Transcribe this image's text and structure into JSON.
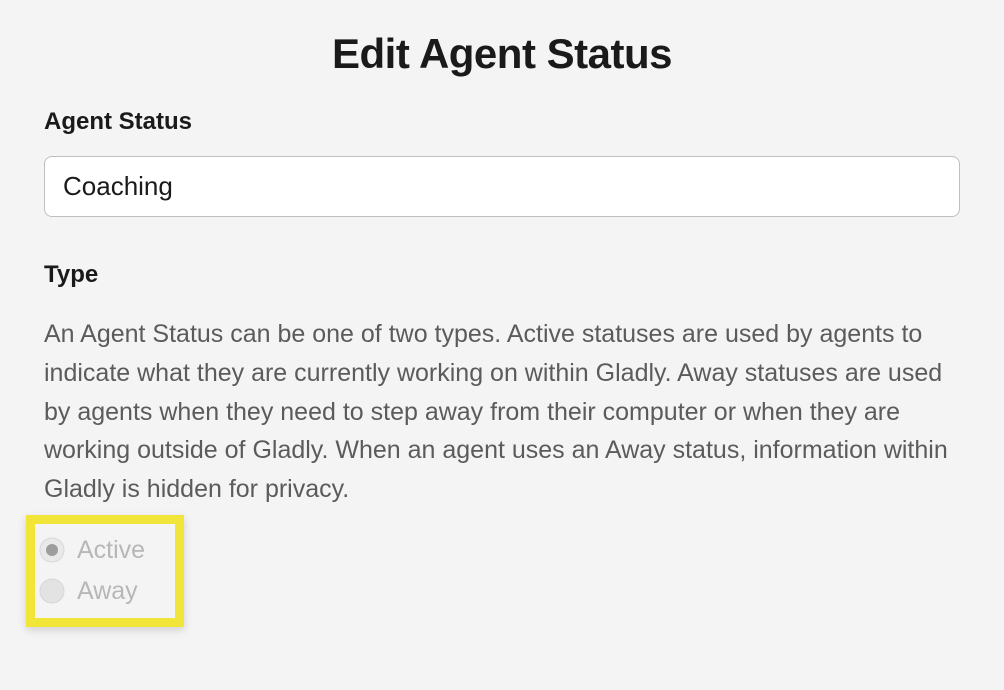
{
  "page_title": "Edit Agent Status",
  "agent_status": {
    "label": "Agent Status",
    "value": "Coaching"
  },
  "type_section": {
    "label": "Type",
    "description": "An Agent Status can be one of two types. Active statuses are used by agents to indicate what they are currently working on within Gladly. Away statuses are used by agents when they need to step away from their computer or when they are working outside of Gladly. When an agent uses an Away status, information within Gladly is hidden for privacy.",
    "options": {
      "active": {
        "label": "Active",
        "selected": true,
        "disabled": true
      },
      "away": {
        "label": "Away",
        "selected": false,
        "disabled": true
      }
    }
  }
}
